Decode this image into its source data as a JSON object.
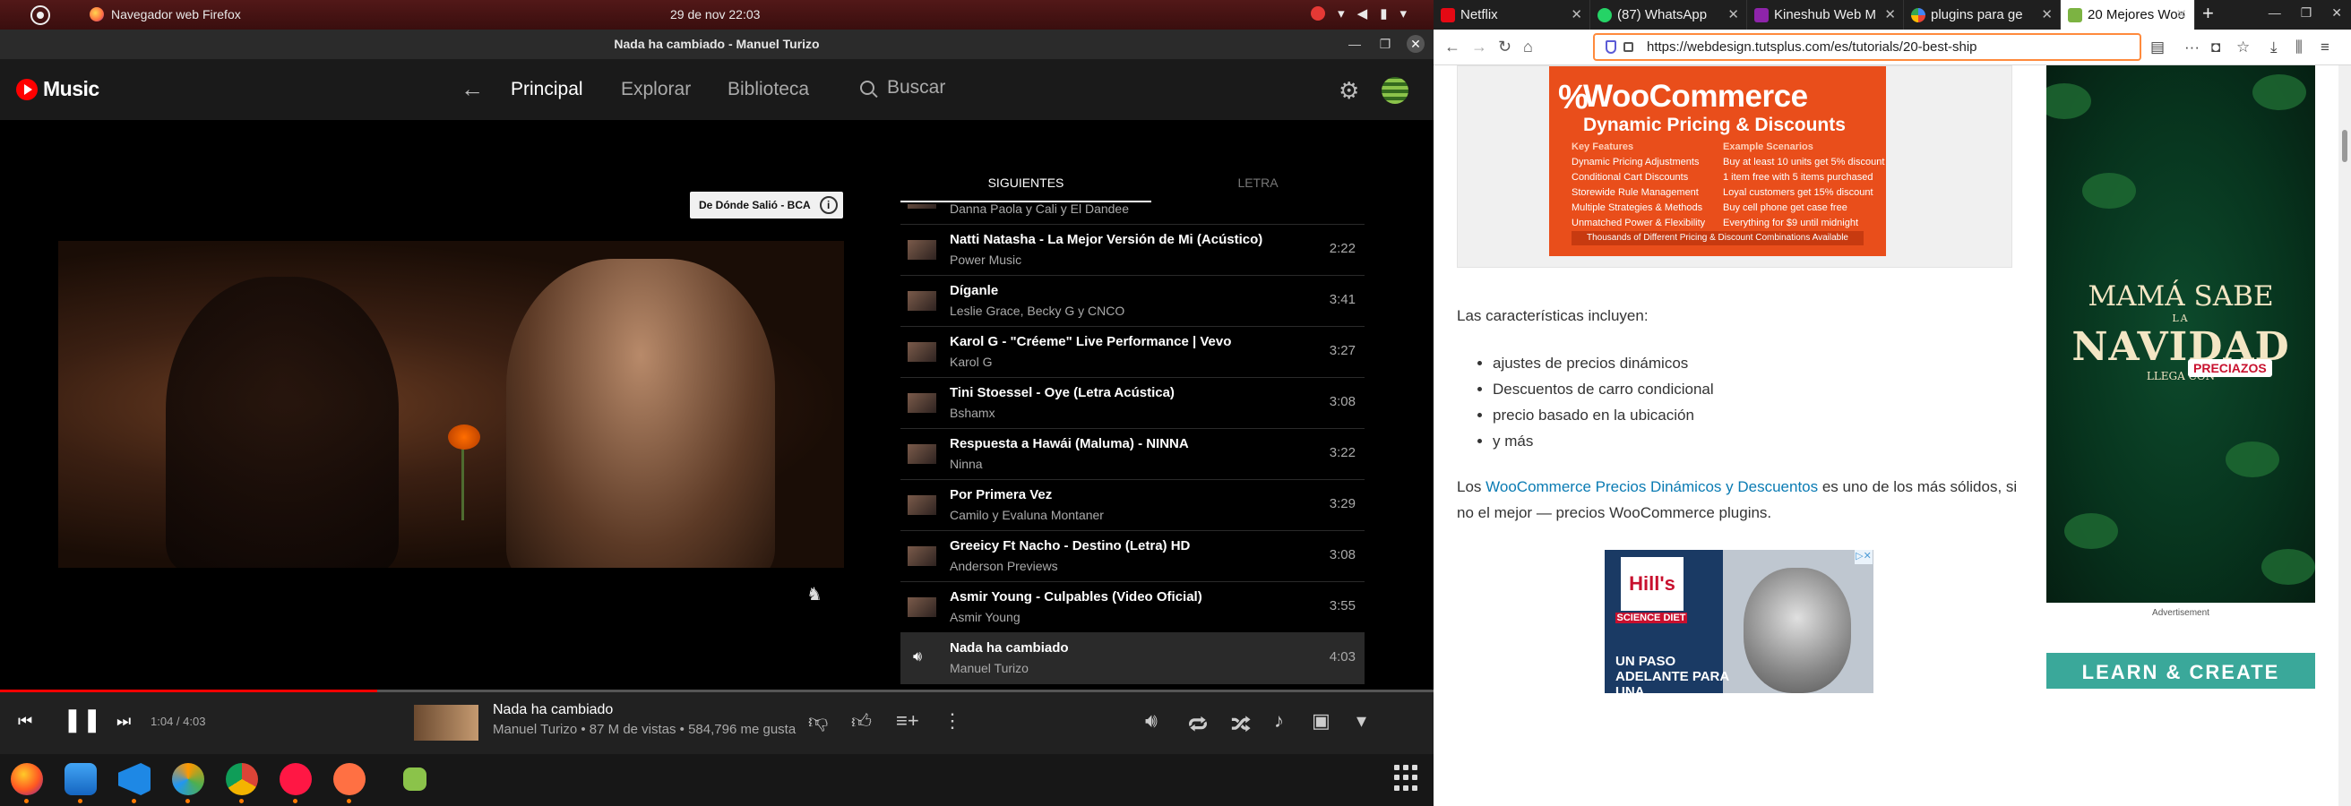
{
  "system": {
    "app_name": "Navegador web Firefox",
    "clock": "29 de nov  22:03"
  },
  "window": {
    "title": "Nada ha cambiado - Manuel Turizo"
  },
  "ytm": {
    "logo": "Music",
    "nav": [
      "Principal",
      "Explorar",
      "Biblioteca"
    ],
    "search": "Buscar",
    "chip": "De Dónde Salió - BCA",
    "tabs": [
      "SIGUIENTES",
      "LETRA"
    ],
    "queue": [
      {
        "title": "",
        "artist": "Danna Paola y Cali y El Dandee",
        "duration": ""
      },
      {
        "title": "Natti Natasha - La Mejor Versión de Mi (Acústico)",
        "artist": "Power Music",
        "duration": "2:22"
      },
      {
        "title": "Díganle",
        "artist": "Leslie Grace, Becky G y CNCO",
        "duration": "3:41"
      },
      {
        "title": "Karol G - \"Créeme\" Live Performance | Vevo",
        "artist": "Karol G",
        "duration": "3:27"
      },
      {
        "title": "Tini Stoessel - Oye (Letra Acústica)",
        "artist": "Bshamx",
        "duration": "3:08"
      },
      {
        "title": "Respuesta a Hawái (Maluma) - NINNA",
        "artist": "Ninna",
        "duration": "3:22"
      },
      {
        "title": "Por Primera Vez",
        "artist": "Camilo y Evaluna Montaner",
        "duration": "3:29"
      },
      {
        "title": "Greeicy Ft Nacho - Destino (Letra) HD",
        "artist": "Anderson Previews",
        "duration": "3:08"
      },
      {
        "title": "Asmir Young - Culpables (Video Oficial)",
        "artist": "Asmir Young",
        "duration": "3:55"
      },
      {
        "title": "Nada ha cambiado",
        "artist": "Manuel Turizo",
        "duration": "4:03"
      }
    ],
    "player": {
      "time": "1:04 / 4:03",
      "progress": 0.263,
      "title": "Nada ha cambiado",
      "subtitle": "Manuel Turizo • 87 M de vistas • 584,796 me gusta"
    }
  },
  "firefox": {
    "tabs": [
      "Netflix",
      "(87) WhatsApp",
      "Kineshub Web M",
      "plugins para ge",
      "20 Mejores Woo"
    ],
    "url": "https://webdesign.tutsplus.com/es/tutorials/20-best-ship"
  },
  "article": {
    "ad_title": "WooCommerce",
    "ad_subtitle": "Dynamic Pricing & Discounts",
    "ad_features_head": "Key Features",
    "ad_features": [
      "Dynamic Pricing Adjustments",
      "Conditional Cart Discounts",
      "Storewide Rule Management",
      "Multiple Strategies & Methods",
      "Unmatched Power & Flexibility"
    ],
    "ad_examples_head": "Example Scenarios",
    "ad_examples": [
      "Buy at least 10 units get 5% discount",
      "1 item free with 5 items purchased",
      "Loyal customers get 15% discount",
      "Buy cell phone get case free",
      "Everything for $9 until midnight"
    ],
    "ad_footer": "Thousands of Different Pricing & Discount Combinations Available",
    "intro": "Las características incluyen:",
    "bullets": [
      "ajustes de precios dinámicos",
      "Descuentos de carro condicional",
      "precio basado en la ubicación",
      "y más"
    ],
    "p2_pre": "Los ",
    "p2_link": "WooCommerce Precios Dinámicos y Descuentos",
    "p2_post": " es uno de los más sólidos, si no el mejor — precios WooCommerce plugins.",
    "hills_brand": "Hill's",
    "hills_sd": "SCIENCE DIET",
    "hills_text": "UN PASO ADELANTE PARA UNA",
    "side_ad": {
      "l1": "MAMÁ SABE",
      "l2": "LA",
      "l3": "NAVIDAD",
      "l4": "LLEGA CON",
      "brand": "PRECIAZOS"
    },
    "advertisement": "Advertisement",
    "learn": "LEARN & CREATE"
  }
}
